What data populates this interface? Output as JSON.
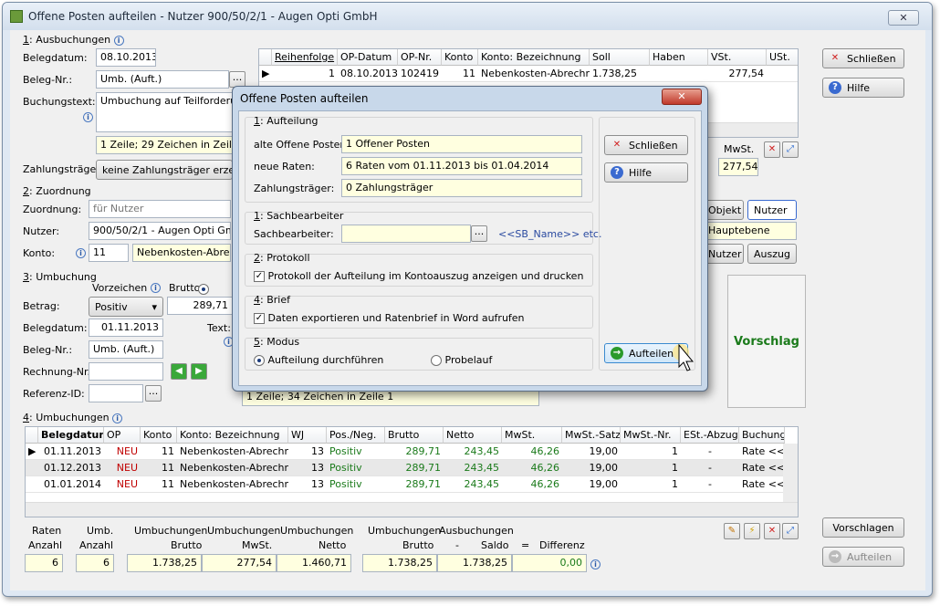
{
  "window": {
    "title": "Offene Posten aufteilen - Nutzer 900/50/2/1 - Augen Opti GmbH",
    "close_label": "✕"
  },
  "ausbuchungen": {
    "section_num": "1",
    "section_label": ": Ausbuchungen",
    "belegdatum_label": "Belegdatum:",
    "belegdatum": "08.10.2013",
    "belegnr_label": "Beleg-Nr.:",
    "belegnr": "Umb. (Auft.)",
    "buchungstext_label": "Buchungstext:",
    "buchungstext": "Umbuchung auf Teilforderun",
    "zeile_info": "1 Zeile; 29 Zeichen in Zeile 1",
    "zahlungstraeger_label": "Zahlungsträger:",
    "zahlungstraeger": "keine Zahlungsträger erzeug"
  },
  "top_grid": {
    "headers": [
      "Reihenfolge",
      "OP-Datum",
      "OP-Nr.",
      "Konto",
      "Konto: Bezeichnung",
      "Soll",
      "Haben",
      "VSt.",
      "USt."
    ],
    "row": [
      "1",
      "08.10.2013",
      "102419",
      "11",
      "Nebenkosten-Abrechnur",
      "1.738,25",
      "",
      "277,54",
      ""
    ],
    "mwst_label": "MwSt.",
    "mwst_value": "277,54"
  },
  "zuordnung": {
    "section_num": "2",
    "section_label": ": Zuordnung",
    "zuordnung_label": "Zuordnung:",
    "zuordnung": "für Nutzer",
    "nutzer_label": "Nutzer:",
    "nutzer": "900/50/2/1 - Augen Opti GmbH",
    "konto_label": "Konto:",
    "konto": "11",
    "konto_bez": "Nebenkosten-Abrechn",
    "objekt_btn": "Objekt",
    "nutzer_btn": "Nutzer",
    "ebene": "Hauptebene",
    "nutzer_btn2": "Nutzer",
    "auszug_btn": "Auszug"
  },
  "umbuchung": {
    "section_num": "3",
    "section_label": ": Umbuchung",
    "vorzeichen_label": "Vorzeichen",
    "brutto_label": "Brutto",
    "betrag_label": "Betrag:",
    "betrag_select": "Positiv",
    "betrag_value": "289,71",
    "belegdatum_label": "Belegdatum:",
    "belegdatum": "01.11.2013",
    "text_label": "Text:",
    "belegnr_label": "Beleg-Nr.:",
    "belegnr": "Umb. (Auft.)",
    "rechnungnr_label": "Rechnung-Nr.:",
    "rechnungnr": "",
    "referenz_label": "Referenz-ID:",
    "referenz": "",
    "zeile_info": "1 Zeile; 34 Zeichen in Zeile 1",
    "vorschlag": "Vorschlag"
  },
  "umbuchungen": {
    "section_num": "4",
    "section_label": ": Umbuchungen",
    "headers": [
      "Belegdatum",
      "OP",
      "Konto",
      "Konto: Bezeichnung",
      "WJ",
      "Pos./Neg.",
      "Brutto",
      "Netto",
      "MwSt.",
      "MwSt.-Satz",
      "MwSt.-Nr.",
      "ESt.-Abzug",
      "Buchung"
    ],
    "rows": [
      [
        "01.11.2013",
        "NEU",
        "11",
        "Nebenkosten-Abrechnur",
        "13",
        "Positiv",
        "289,71",
        "243,45",
        "46,26",
        "19,00",
        "1",
        "-",
        "Rate <<F"
      ],
      [
        "01.12.2013",
        "NEU",
        "11",
        "Nebenkosten-Abrechnur",
        "13",
        "Positiv",
        "289,71",
        "243,45",
        "46,26",
        "19,00",
        "1",
        "-",
        "Rate <<F"
      ],
      [
        "01.01.2014",
        "NEU",
        "11",
        "Nebenkosten-Abrechnur",
        "13",
        "Positiv",
        "289,71",
        "243,45",
        "46,26",
        "19,00",
        "1",
        "-",
        "Rate <<F"
      ]
    ]
  },
  "totals": {
    "h1a": "Raten",
    "h1b": "Anzahl",
    "v1": "6",
    "h2a": "Umb.",
    "h2b": "Anzahl",
    "v2": "6",
    "h3a": "Umbuchungen",
    "h3b": "Brutto",
    "v3": "1.738,25",
    "h4a": "Umbuchungen",
    "h4b": "MwSt.",
    "v4": "277,54",
    "h5a": "Umbuchungen",
    "h5b": "Netto",
    "v5": "1.460,71",
    "h6a": "Umbuchungen",
    "h6b": "Brutto",
    "v6": "1.738,25",
    "h7a": "Ausbuchungen",
    "h7b": "Saldo",
    "v7": "1.738,25",
    "minus": "-",
    "eq": "=",
    "h8b": "Differenz",
    "v8": "0,00"
  },
  "right_buttons": {
    "schliessen": "Schließen",
    "hilfe": "Hilfe",
    "vorschlagen": "Vorschlagen",
    "aufteilen": "Aufteilen"
  },
  "dialog": {
    "title": "Offene Posten aufteilen",
    "close_label": "✕",
    "s1_num": "1",
    "s1_label": ": Aufteilung",
    "alte_label": "alte Offene Posten:",
    "alte": "1 Offener Posten",
    "neue_label": "neue Raten:",
    "neue": "6 Raten vom 01.11.2013 bis 01.04.2014",
    "zt_label": "Zahlungsträger:",
    "zt": "0 Zahlungsträger",
    "s2_num": "1",
    "s2_label": ": Sachbearbeiter",
    "sb_label": "Sachbearbeiter:",
    "sb_hint": "<<SB_Name>> etc.",
    "s3_num": "2",
    "s3_label": ": Protokoll",
    "protokoll": "Protokoll der Aufteilung im Kontoauszug anzeigen und drucken",
    "s4_num": "4",
    "s4_label": ": Brief",
    "brief": "Daten exportieren und Ratenbrief in Word aufrufen",
    "s5_num": "5",
    "s5_label": ": Modus",
    "modus1": "Aufteilung durchführen",
    "modus2": "Probelauf",
    "btn_schliessen": "Schließen",
    "btn_hilfe": "Hilfe",
    "btn_aufteilen": "Aufteilen"
  }
}
